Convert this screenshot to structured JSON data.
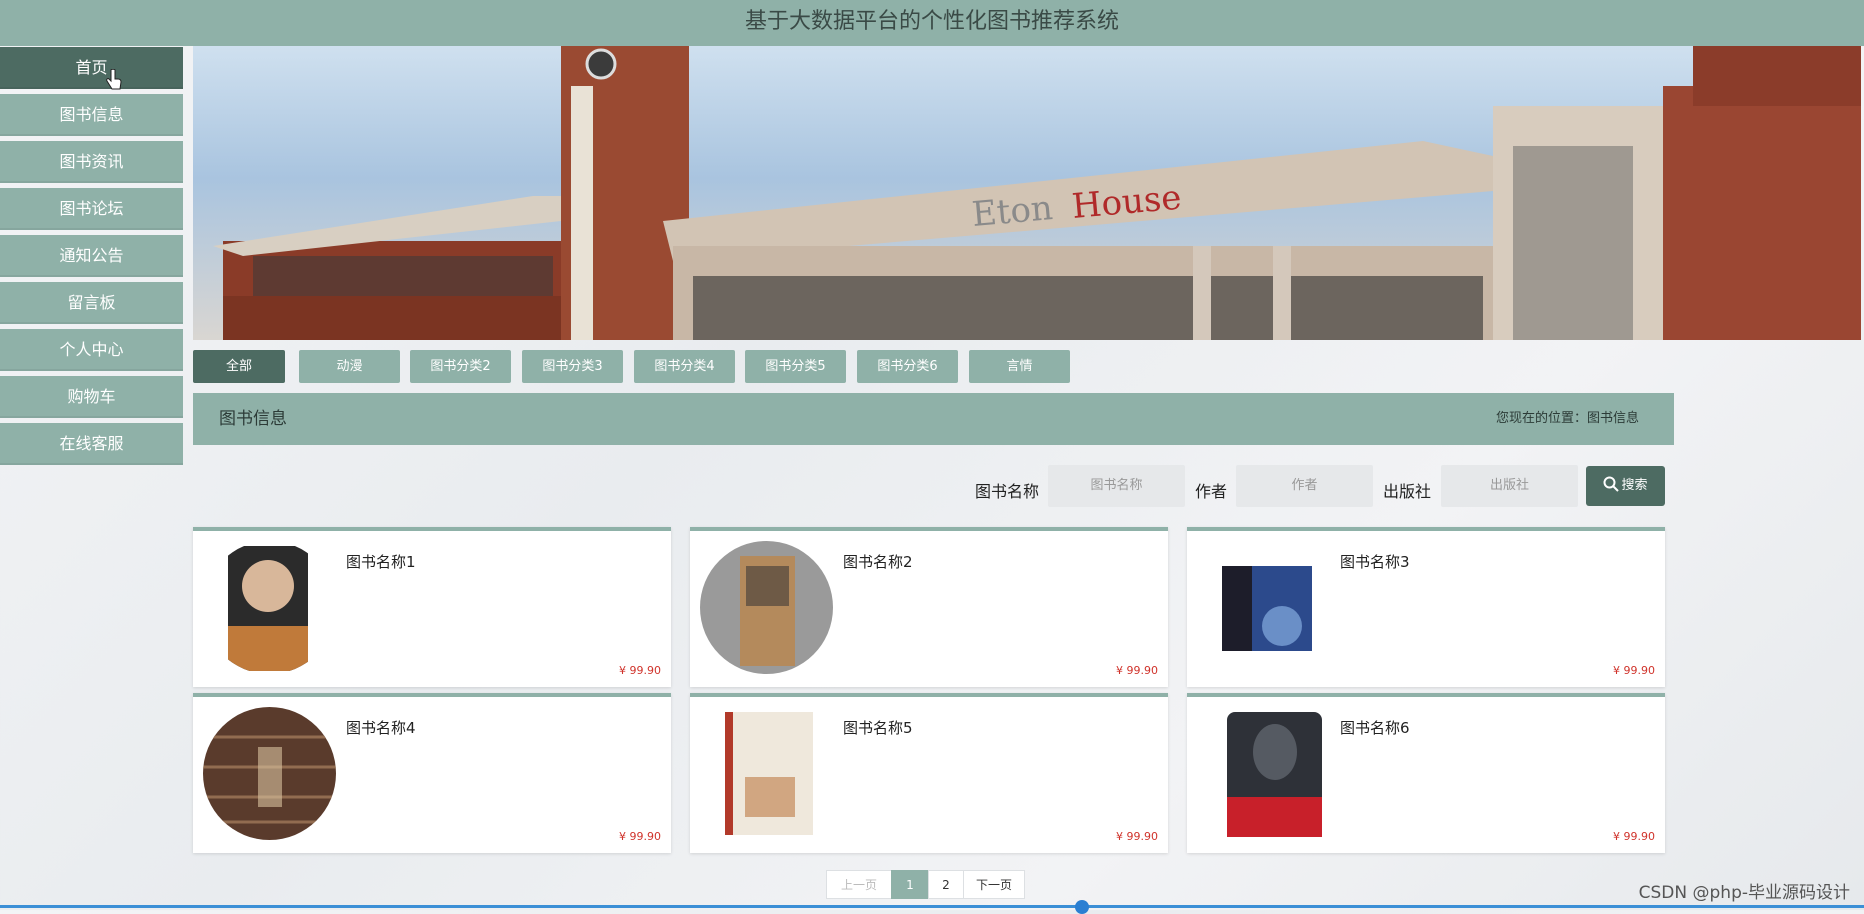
{
  "header": {
    "title": "基于大数据平台的个性化图书推荐系统"
  },
  "sidebar": {
    "items": [
      {
        "label": "首页",
        "active": true
      },
      {
        "label": "图书信息"
      },
      {
        "label": "图书资讯"
      },
      {
        "label": "图书论坛"
      },
      {
        "label": "通知公告"
      },
      {
        "label": "留言板"
      },
      {
        "label": "个人中心"
      },
      {
        "label": "购物车"
      },
      {
        "label": "在线客服"
      }
    ]
  },
  "banner": {
    "sign": "Eton House"
  },
  "tabs": [
    {
      "label": "全部",
      "active": true
    },
    {
      "label": "动漫"
    },
    {
      "label": "图书分类2"
    },
    {
      "label": "图书分类3"
    },
    {
      "label": "图书分类4"
    },
    {
      "label": "图书分类5"
    },
    {
      "label": "图书分类6"
    },
    {
      "label": "言情"
    }
  ],
  "section": {
    "title": "图书信息",
    "breadcrumb": "您现在的位置：图书信息"
  },
  "search": {
    "name_label": "图书名称",
    "name_placeholder": "图书名称",
    "author_label": "作者",
    "author_placeholder": "作者",
    "publisher_label": "出版社",
    "publisher_placeholder": "出版社",
    "button_label": "搜索"
  },
  "books": [
    {
      "name": "图书名称1",
      "price": "¥ 99.90",
      "thumb_color": "#b08660"
    },
    {
      "name": "图书名称2",
      "price": "¥ 99.90",
      "thumb_color": "#a89a86"
    },
    {
      "name": "图书名称3",
      "price": "¥ 99.90",
      "thumb_color": "#2c4a8c"
    },
    {
      "name": "图书名称4",
      "price": "¥ 99.90",
      "thumb_color": "#6b4a3a"
    },
    {
      "name": "图书名称5",
      "price": "¥ 99.90",
      "thumb_color": "#c9b9a3"
    },
    {
      "name": "图书名称6",
      "price": "¥ 99.90",
      "thumb_color": "#3a3f48"
    }
  ],
  "pager": {
    "prev": "上一页",
    "pages": [
      "1",
      "2"
    ],
    "current": "1",
    "next": "下一页"
  },
  "watermark": "CSDN @php-毕业源码设计",
  "colors": {
    "accent": "#8fb1a8",
    "accent_dark": "#4d6b62",
    "price": "#d0332b"
  }
}
